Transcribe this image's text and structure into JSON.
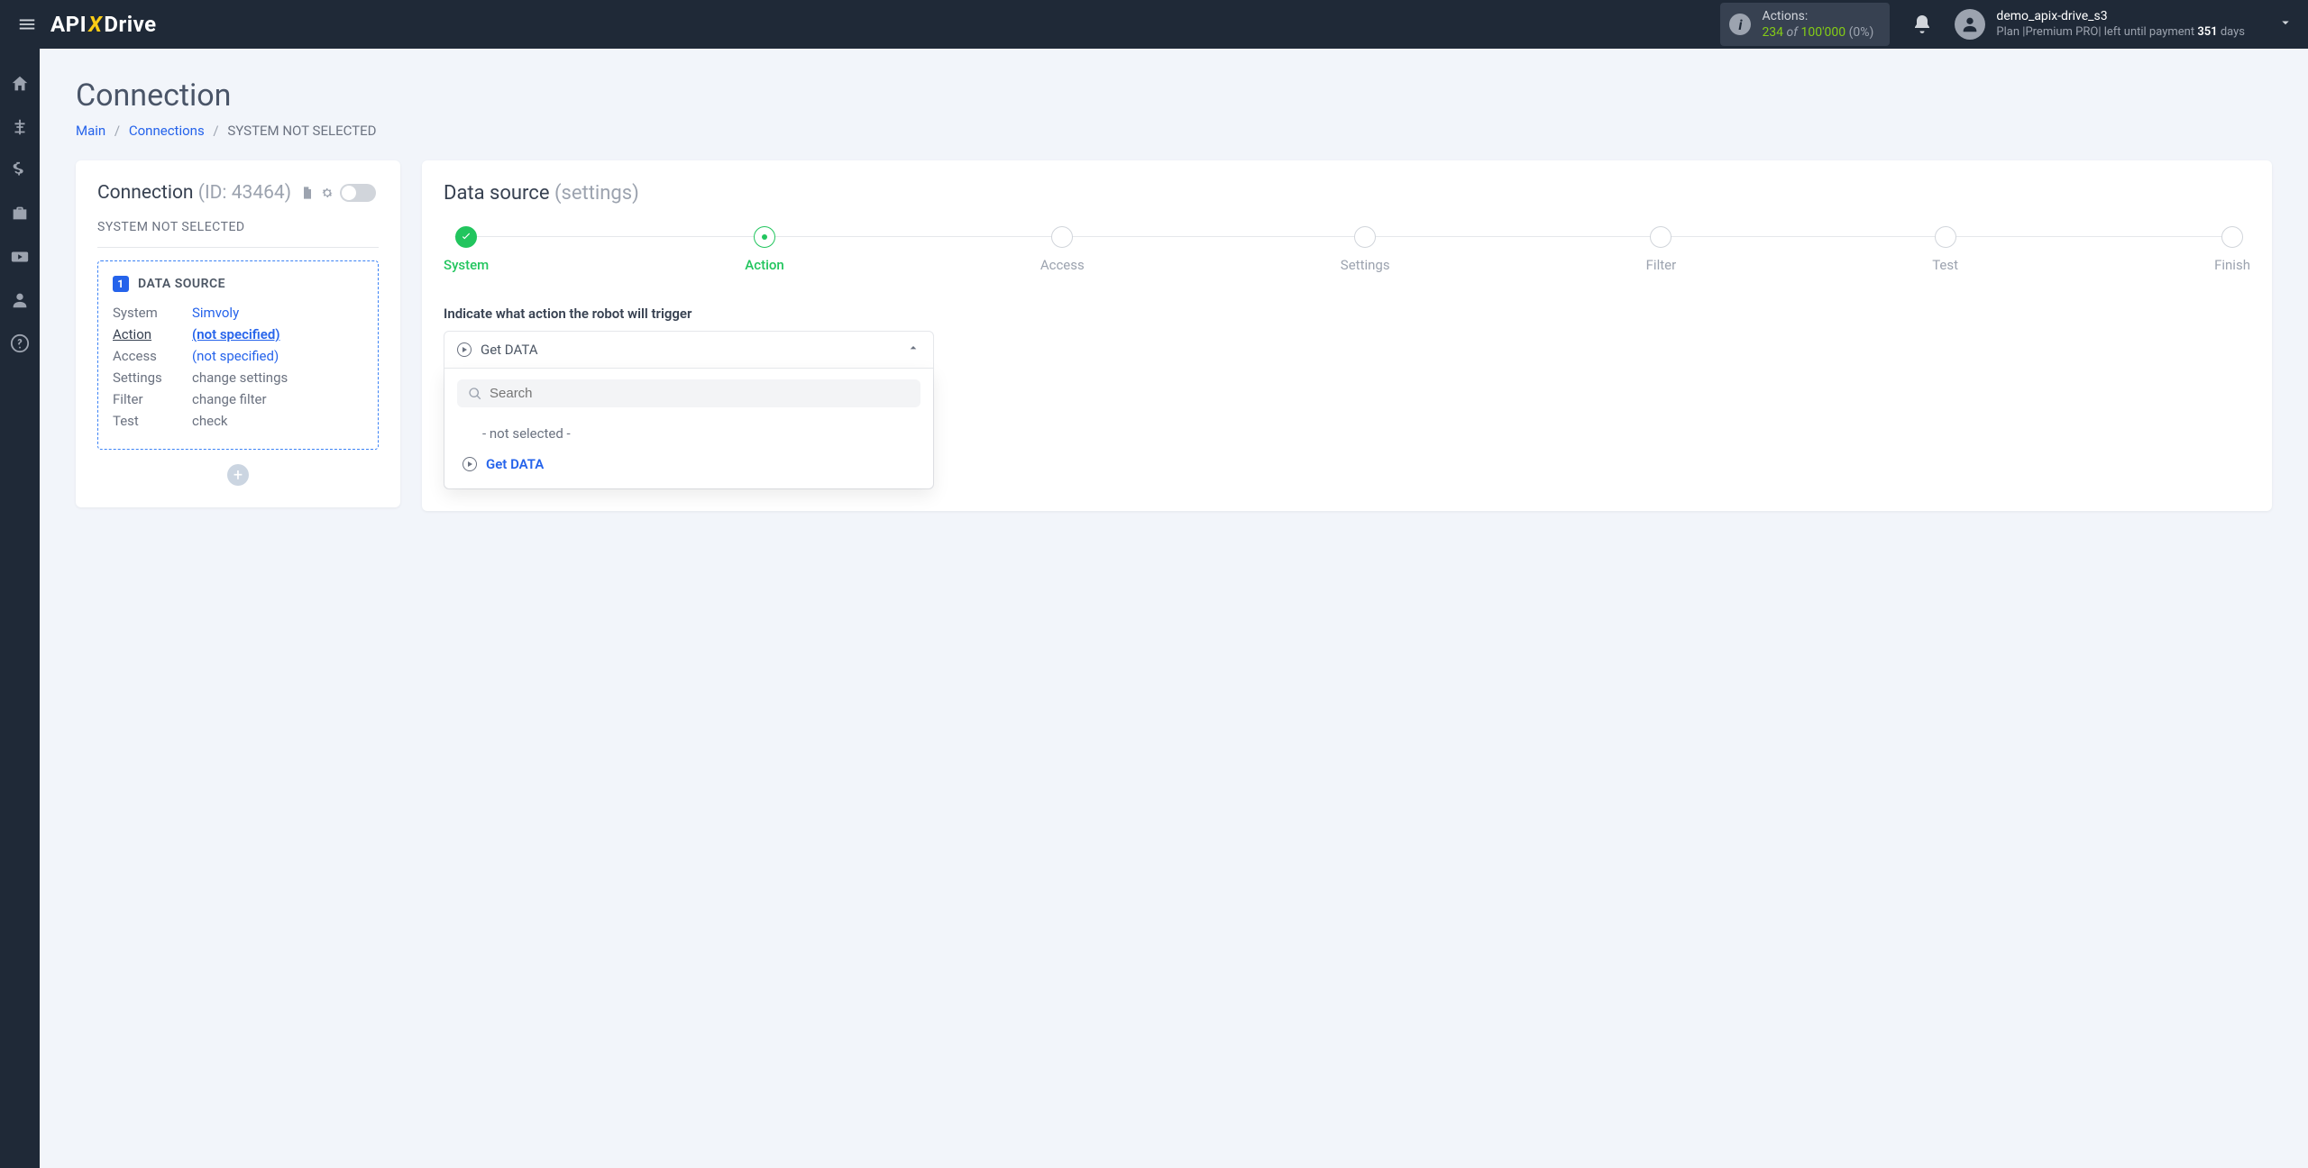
{
  "header": {
    "actions": {
      "label": "Actions:",
      "count": "234",
      "of": "of",
      "limit": "100'000",
      "pct": "(0%)"
    },
    "user": {
      "name": "demo_apix-drive_s3",
      "plan_prefix": "Plan |",
      "plan": "Premium PRO",
      "plan_mid": "| left until payment",
      "days": "351",
      "days_suffix": "days"
    }
  },
  "breadcrumb": {
    "main": "Main",
    "connections": "Connections",
    "current": "SYSTEM NOT SELECTED"
  },
  "page_title": "Connection",
  "left_panel": {
    "title": "Connection",
    "id": "(ID: 43464)",
    "subtitle": "SYSTEM NOT SELECTED",
    "ds_badge": "1",
    "ds_title": "DATA SOURCE",
    "rows": {
      "system_key": "System",
      "system_val": "Simvoly",
      "action_key": "Action",
      "action_val": "(not specified)",
      "access_key": "Access",
      "access_val": "(not specified)",
      "settings_key": "Settings",
      "settings_val": "change settings",
      "filter_key": "Filter",
      "filter_val": "change filter",
      "test_key": "Test",
      "test_val": "check"
    }
  },
  "right_panel": {
    "title": "Data source",
    "title_sub": "(settings)",
    "steps": [
      "System",
      "Action",
      "Access",
      "Settings",
      "Filter",
      "Test",
      "Finish"
    ],
    "field_label": "Indicate what action the robot will trigger",
    "selected": "Get DATA",
    "search_placeholder": "Search",
    "opt_none": "- not selected -",
    "opt_get": "Get DATA"
  }
}
